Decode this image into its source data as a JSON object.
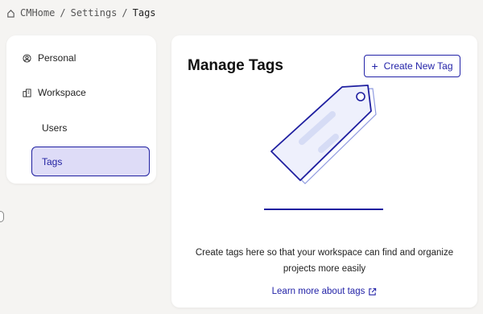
{
  "breadcrumb": {
    "home": "CMHome",
    "sep1": "/",
    "settings": "Settings",
    "sep2": "/",
    "current": "Tags"
  },
  "sidebar": {
    "items": [
      {
        "label": "Personal",
        "icon": "user-circle-icon"
      },
      {
        "label": "Workspace",
        "icon": "building-icon"
      },
      {
        "label": "Users"
      },
      {
        "label": "Tags",
        "selected": true
      }
    ]
  },
  "main": {
    "title": "Manage Tags",
    "create_button": "Create New Tag",
    "description": "Create tags here so that your workspace can find and organize projects more easily",
    "learn_more": "Learn more about tags"
  },
  "colors": {
    "accent": "#2323a8",
    "selected_bg": "#dedcf7",
    "illustration_fill": "#eef0fc",
    "illustration_stripes": "#d6dcf5"
  }
}
